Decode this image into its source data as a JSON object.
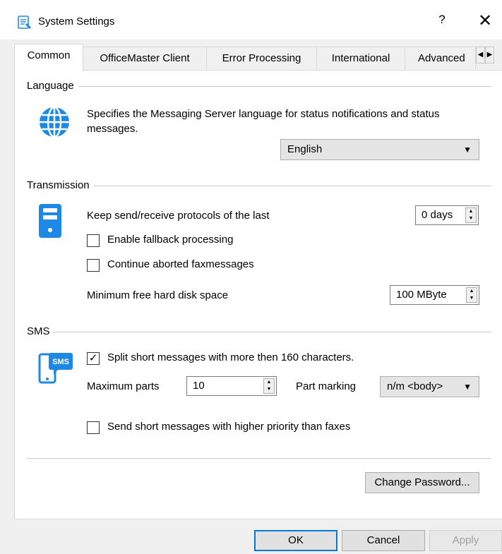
{
  "window": {
    "title": "System Settings",
    "help_label": "?",
    "close_label": "✕"
  },
  "tabs": [
    {
      "label": "Common",
      "active": true
    },
    {
      "label": "OfficeMaster Client"
    },
    {
      "label": "Error Processing"
    },
    {
      "label": "International"
    },
    {
      "label": "Advanced"
    }
  ],
  "tab_scroll": {
    "left": "◀",
    "right": "▶"
  },
  "language": {
    "group_label": "Language",
    "description": "Specifies the Messaging Server language for status notifications and status messages.",
    "selected": "English",
    "icon": "globe-icon"
  },
  "transmission": {
    "group_label": "Transmission",
    "icon": "server-icon",
    "keep_protocols_label": "Keep send/receive protocols of the last",
    "keep_protocols_value": "0 days",
    "fallback_label": "Enable fallback processing",
    "fallback_checked": false,
    "continue_aborted_label": "Continue aborted faxmessages",
    "continue_aborted_checked": false,
    "min_disk_label": "Minimum free hard disk space",
    "min_disk_value": "100 MByte"
  },
  "sms": {
    "group_label": "SMS",
    "icon": "sms-phone-icon",
    "icon_text": "SMS",
    "split_label": "Split short messages with more then 160 characters.",
    "split_checked": true,
    "split_mark": "✓",
    "max_parts_label": "Maximum parts",
    "max_parts_value": "10",
    "part_marking_label": "Part marking",
    "part_marking_value": "n/m <body>",
    "priority_label": "Send short messages with higher priority than faxes",
    "priority_checked": false
  },
  "change_password_label": "Change Password...",
  "footer": {
    "ok_label": "OK",
    "cancel_label": "Cancel",
    "apply_label": "Apply"
  },
  "colors": {
    "accent": "#0078d7",
    "icon_blue": "#1e88e5"
  }
}
